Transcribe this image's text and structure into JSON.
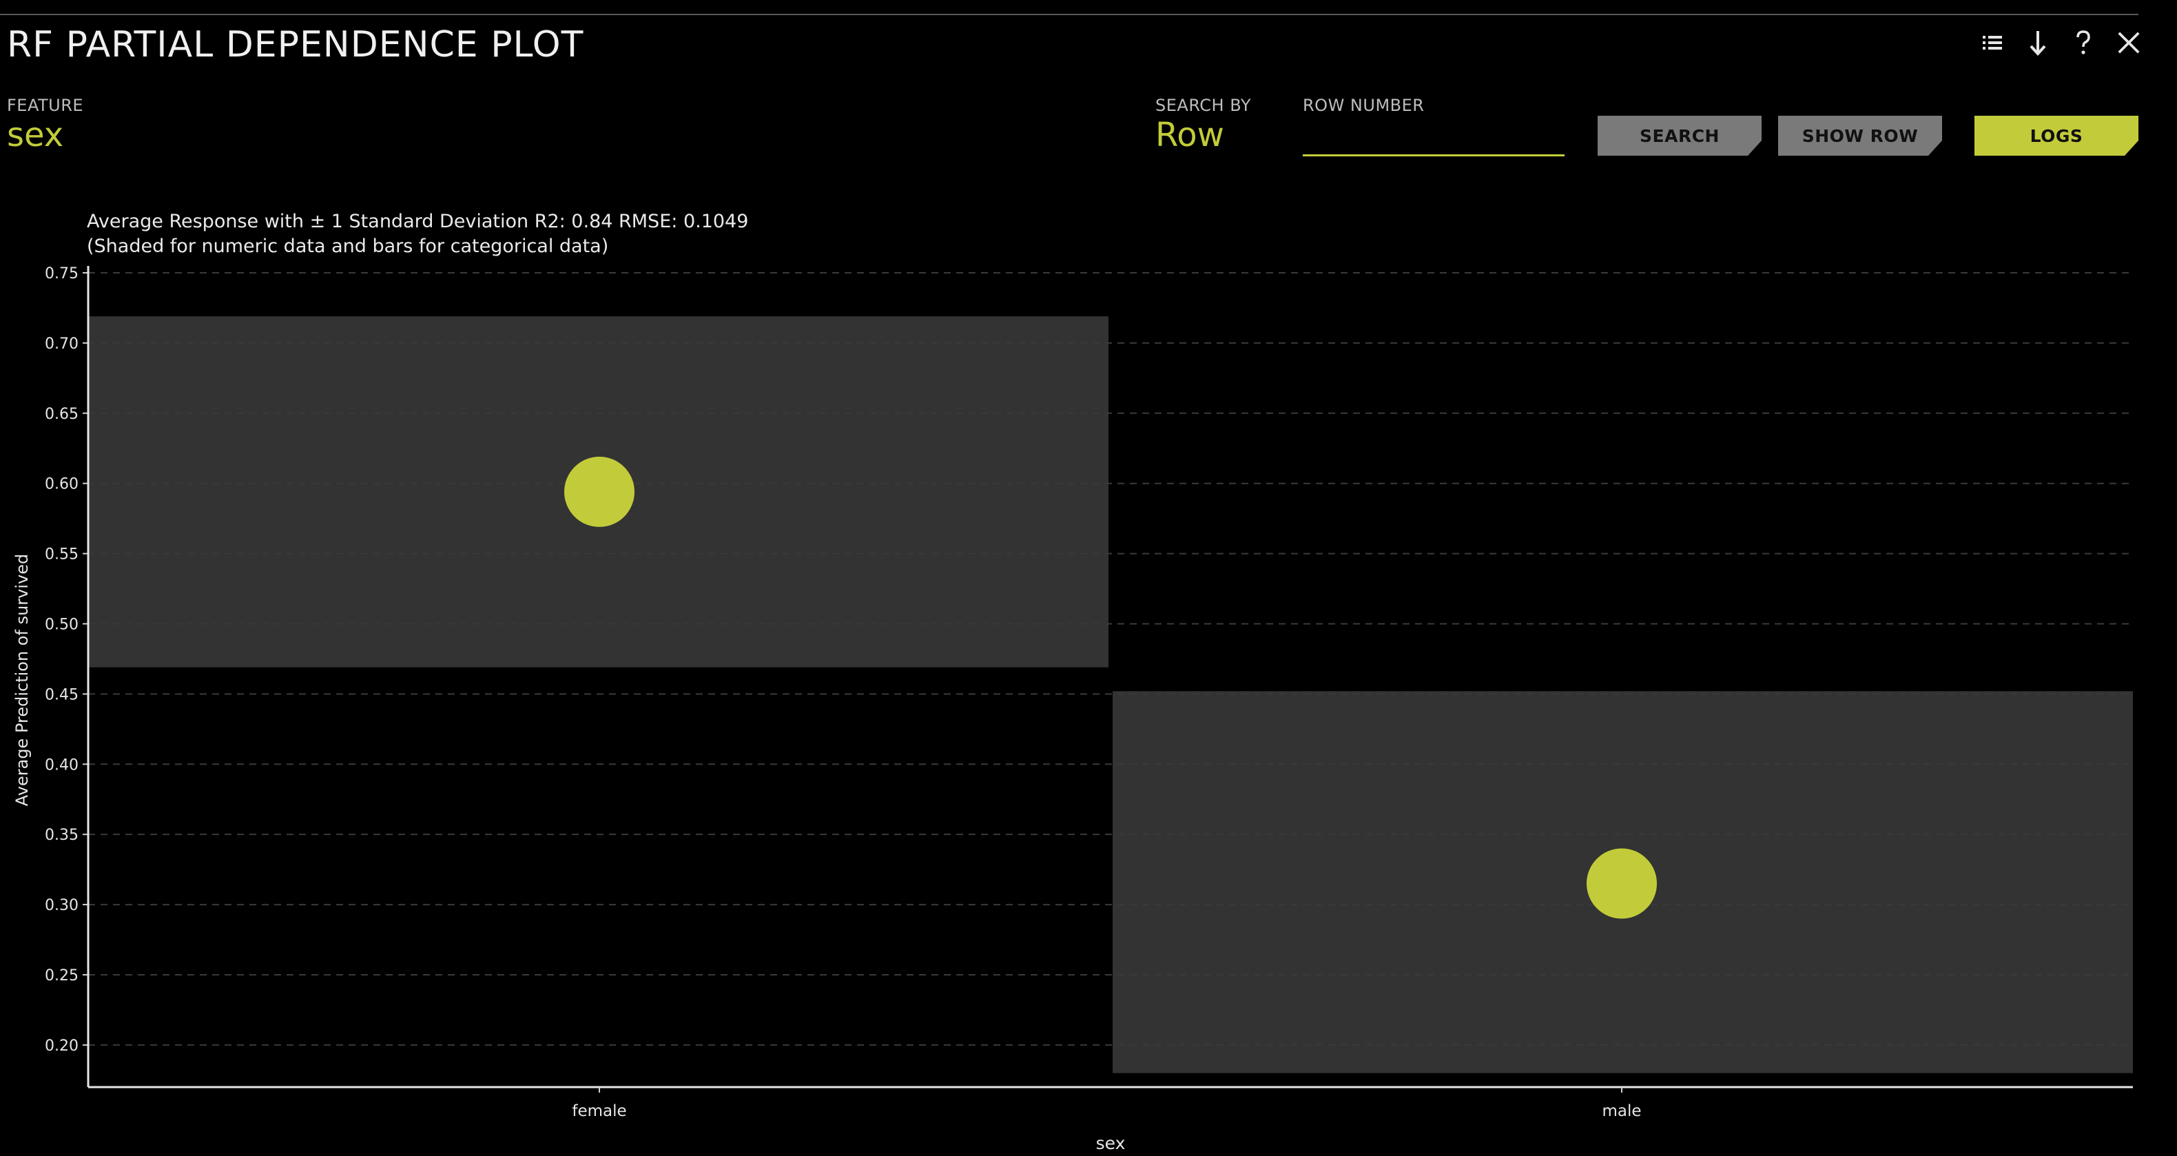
{
  "window": {
    "title": "RF PARTIAL DEPENDENCE PLOT",
    "actions": [
      {
        "name": "list-icon",
        "label": "list"
      },
      {
        "name": "download-icon",
        "label": "download"
      },
      {
        "name": "help-icon",
        "label": "?"
      },
      {
        "name": "close-icon",
        "label": "close"
      }
    ]
  },
  "feature": {
    "label": "FEATURE",
    "value": "sex"
  },
  "search_by": {
    "label": "SEARCH BY",
    "value": "Row"
  },
  "row_number": {
    "label": "ROW NUMBER",
    "value": "",
    "placeholder": ""
  },
  "buttons": {
    "search": "SEARCH",
    "show_row": "SHOW ROW",
    "logs": "LOGS"
  },
  "colors": {
    "background": "#000000",
    "accent": "#c2cc3a",
    "band": "#333333",
    "button_gray": "#7a7a7a",
    "grid": "#3a3a3a"
  },
  "chart_data": {
    "type": "scatter",
    "title": "Average Response with ± 1 Standard Deviation R2: 0.84 RMSE: 0.1049",
    "subtitle": "(Shaded for numeric data and bars for categorical data)",
    "xlabel": "sex",
    "ylabel": "Average Prediction of survived",
    "categories": [
      "female",
      "male"
    ],
    "values": [
      0.594,
      0.315
    ],
    "std_band": [
      {
        "category": "female",
        "low": 0.469,
        "high": 0.719
      },
      {
        "category": "male",
        "low": 0.18,
        "high": 0.452
      }
    ],
    "ylim": [
      0.17,
      0.75
    ],
    "yticks": [
      "0.20",
      "0.25",
      "0.30",
      "0.35",
      "0.40",
      "0.45",
      "0.50",
      "0.55",
      "0.60",
      "0.65",
      "0.70",
      "0.75"
    ],
    "grid": "horizontal dashed"
  }
}
